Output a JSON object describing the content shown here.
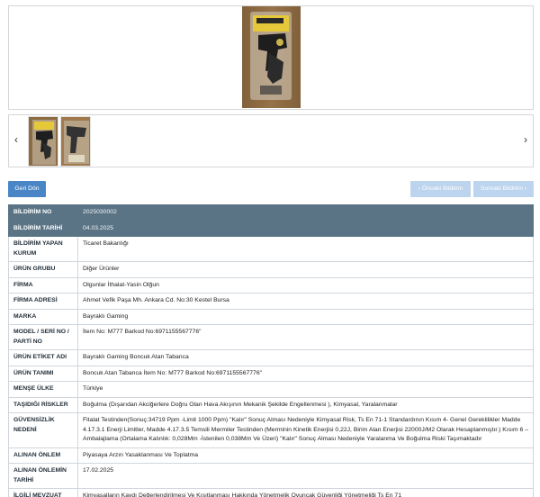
{
  "gallery": {
    "prev_label": "‹",
    "next_label": "›"
  },
  "actions": {
    "back_label": "Geri Dön",
    "prev_label": "‹ Önceki Bildirim",
    "next_label": "Sonraki Bildirim ›"
  },
  "rows": [
    {
      "key": "BİLDİRİM NO",
      "value": "2025030002"
    },
    {
      "key": "BİLDİRİM TARİHİ",
      "value": "04.03.2025"
    },
    {
      "key": "BİLDİRİM YAPAN KURUM",
      "value": "Ticaret Bakanlığı"
    },
    {
      "key": "ÜRÜN GRUBU",
      "value": "Diğer Ürünler"
    },
    {
      "key": "FİRMA",
      "value": "Olgunlar İthalat-Yasin Olğun"
    },
    {
      "key": "FİRMA ADRESİ",
      "value": "Ahmet Vefik Paşa Mh. Ankara Cd. No:30 Kestel Bursa"
    },
    {
      "key": "MARKA",
      "value": "Bayraklı Gaming"
    },
    {
      "key": "MODEL / SERİ NO / PARTİ NO",
      "value": "İtem No: M777 Barkod No:6971155567776\""
    },
    {
      "key": "ÜRÜN ETİKET ADI",
      "value": "Bayraklı Gaming Boncuk Atan Tabanca"
    },
    {
      "key": "ÜRÜN TANIMI",
      "value": "Boncuk Atan Tabanca İtem No: M777 Barkod No:6971155567776\""
    },
    {
      "key": "MENŞE ÜLKE",
      "value": "Türkiye"
    },
    {
      "key": "TAŞIDIĞI RİSKLER",
      "value": "Boğulma (Dışarıdan Akciğerlere Doğru Olan Hava Akışının Mekanik Şekilde Engellenmesi ), Kimyasal, Yaralanmalar"
    },
    {
      "key": "GÜVENSİZLİK NEDENİ",
      "value": "Fitalat Testinden(Sonuç:34719 Ppm -Limit 1000 Ppm) \"Kalır\" Sonuç Alması Nedeniyle Kimyasal Risk, Ts En 71-1 Standardının Kısım 4- Genel Gereklilikler Madde 4.17.3.1 Enerji Limitler, Madde 4.17.3.5 Temsili Mermiler Testinden (Merminin Kinetik Enerjisi 0,22J, Birim Alan Enerjisi 22000J/M2 Olarak Hesaplanmıştır.) Kısım 6 – Ambalajlama (Ortalama Kalınlık: 0,028Mm -İstenilen 0,038Mm Ve Üzeri) \"Kalır\" Sonuç Alması Nedeniyle Yaralanma Ve Boğulma Riski Taşımaktadır"
    },
    {
      "key": "ALINAN ÖNLEM",
      "value": "Piyasaya Arzın Yasaklanması Ve Toplatma"
    },
    {
      "key": "ALINAN ÖNLEMİN TARİHİ",
      "value": "17.02.2025"
    },
    {
      "key": "İLGİLİ MEVZUAT",
      "value": "Kimyasalların Kaydı Değerlendirilmesi Ve Kısıtlanması Hakkında Yönetmelik Oyuncak Güvenliği Yönetmeliği Ts En 71"
    }
  ]
}
